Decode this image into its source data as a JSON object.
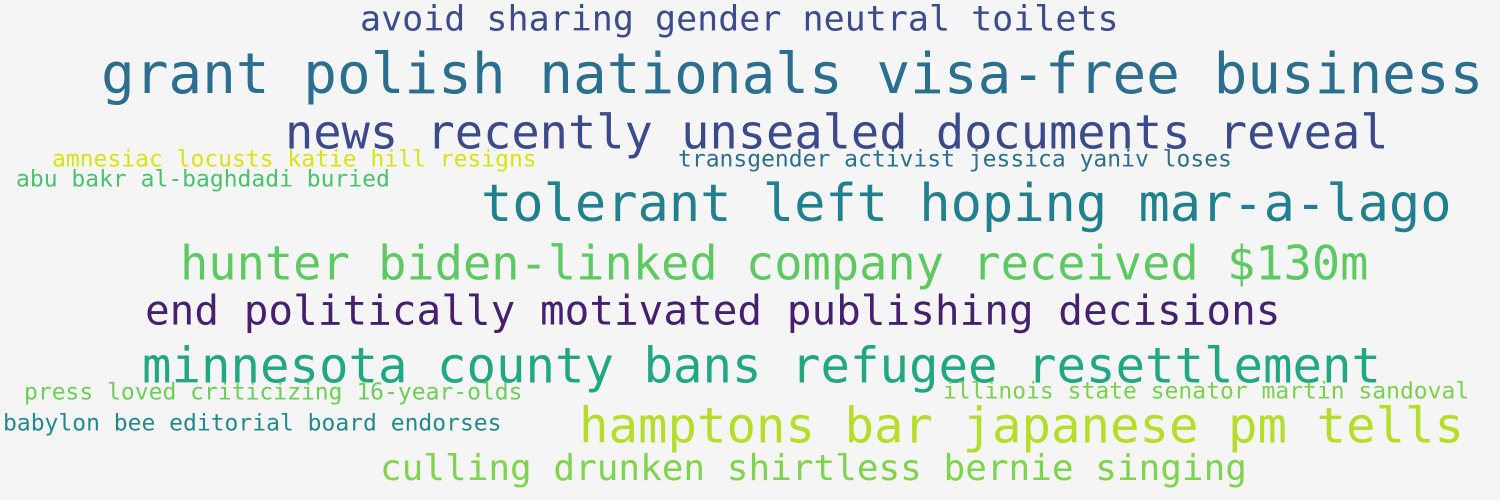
{
  "word_cloud": {
    "background": "#f5f5f5",
    "phrases": [
      {
        "text": "avoid sharing gender neutral toilets",
        "color": "#3b4b8c"
      },
      {
        "text": "grant polish nationals visa-free business",
        "color": "#2c6e8e"
      },
      {
        "text": "news recently unsealed documents reveal",
        "color": "#3b4a8a"
      },
      {
        "text": "amnesiac locusts katie hill resigns",
        "color": "#d8e219"
      },
      {
        "text": "transgender activist jessica yaniv loses",
        "color": "#2d6f8e"
      },
      {
        "text": "abu bakr al-baghdadi buried",
        "color": "#4ac16d"
      },
      {
        "text": "tolerant left hoping mar-a-lago",
        "color": "#21808d"
      },
      {
        "text": "hunter biden-linked company received $130m",
        "color": "#5ec962"
      },
      {
        "text": "end politically motivated publishing decisions",
        "color": "#46206f"
      },
      {
        "text": "minnesota county bans refugee resettlement",
        "color": "#22a784"
      },
      {
        "text": "press loved criticizing 16-year-olds",
        "color": "#6ccd5a"
      },
      {
        "text": "illinois state senator martin sandoval",
        "color": "#7ad151"
      },
      {
        "text": "babylon bee editorial board endorses",
        "color": "#23898e"
      },
      {
        "text": "hamptons bar japanese pm tells",
        "color": "#b5de2b"
      },
      {
        "text": "culling drunken shirtless bernie singing",
        "color": "#7fd34e"
      }
    ]
  }
}
